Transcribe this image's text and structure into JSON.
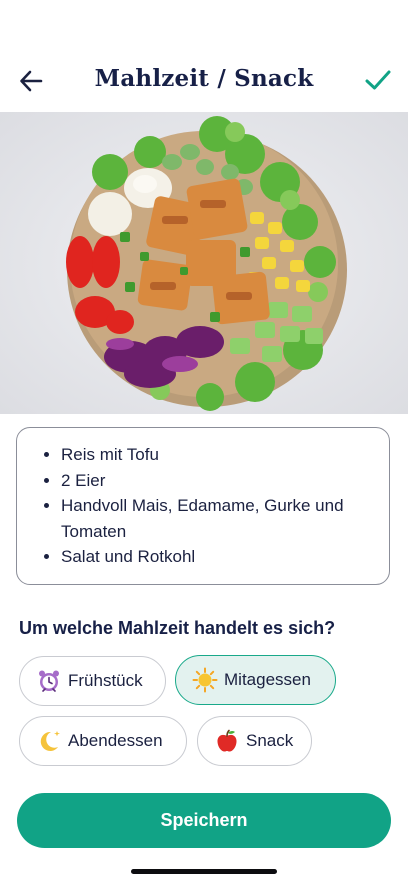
{
  "header": {
    "title": "Mahlzeit / Snack",
    "back_icon": "arrow-left-icon",
    "confirm_icon": "checkmark-icon"
  },
  "photo": {
    "icon": "food-bowl-photo"
  },
  "notes": {
    "items": [
      "Reis mit Tofu",
      "2 Eier",
      "Handvoll Mais, Edamame, Gurke und Tomaten",
      "Salat und Rotkohl"
    ]
  },
  "question": "Um welche Mahlzeit handelt es sich?",
  "meal_options": [
    {
      "label": "Frühstück",
      "icon": "alarm-clock-icon",
      "selected": false
    },
    {
      "label": "Mitagessen",
      "icon": "sun-icon",
      "selected": true
    },
    {
      "label": "Abendessen",
      "icon": "moon-icon",
      "selected": false
    },
    {
      "label": "Snack",
      "icon": "apple-icon",
      "selected": false
    }
  ],
  "save_label": "Speichern",
  "colors": {
    "accent": "#11a386",
    "selected_bg": "#e3f2ef",
    "text": "#172047"
  }
}
